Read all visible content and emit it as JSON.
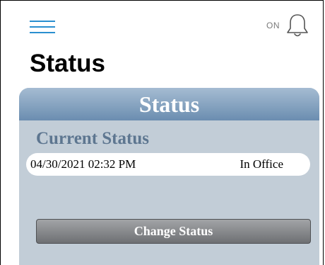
{
  "header": {
    "menu_icon": "hamburger-menu-icon",
    "notifications": {
      "label": "ON",
      "icon": "bell-icon"
    },
    "title": "Status"
  },
  "panel": {
    "title": "Status",
    "section_label": "Current Status",
    "current_status": {
      "datetime": "04/30/2021 02:32 PM",
      "value": "In Office"
    },
    "change_button_label": "Change Status"
  },
  "colors": {
    "accent": "#2a8fd0",
    "panel_bg": "#c2cdd7",
    "panel_header_top": "#a5bcd2",
    "panel_header_bottom": "#6b8db0",
    "section_label": "#5d7690",
    "button": "#86888b"
  }
}
